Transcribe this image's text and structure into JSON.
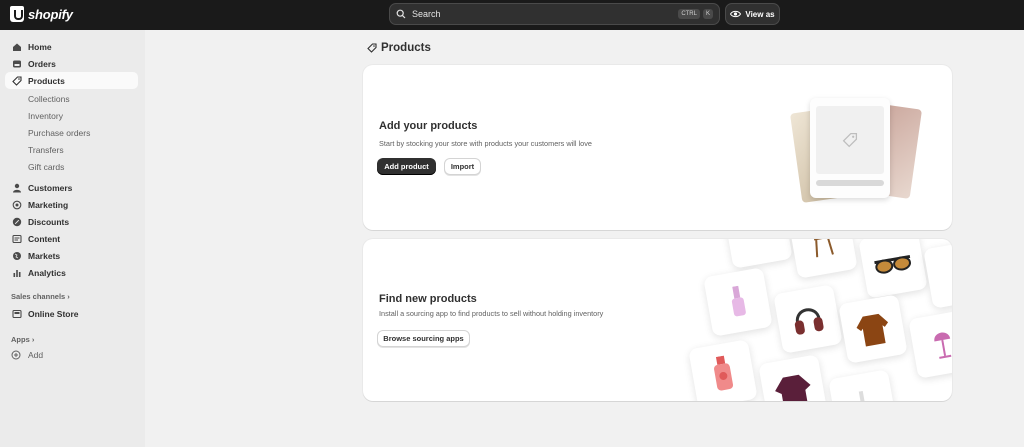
{
  "app": {
    "logo_text": "shopify"
  },
  "search": {
    "placeholder": "Search",
    "shortcut_ctrl": "CTRL",
    "shortcut_key": "K"
  },
  "view_as": {
    "label": "View as"
  },
  "sidebar": {
    "primary": [
      {
        "label": "Home",
        "icon": "home-icon"
      },
      {
        "label": "Orders",
        "icon": "orders-icon"
      },
      {
        "label": "Products",
        "icon": "tag-icon",
        "active": true
      }
    ],
    "product_sub": [
      "Collections",
      "Inventory",
      "Purchase orders",
      "Transfers",
      "Gift cards"
    ],
    "secondary": [
      {
        "label": "Customers",
        "icon": "person-icon"
      },
      {
        "label": "Marketing",
        "icon": "target-icon"
      },
      {
        "label": "Discounts",
        "icon": "discount-icon"
      },
      {
        "label": "Content",
        "icon": "content-icon"
      },
      {
        "label": "Markets",
        "icon": "globe-icon"
      },
      {
        "label": "Analytics",
        "icon": "bar-chart-icon"
      }
    ],
    "sales_channels_label": "Sales channels",
    "online_store": "Online Store",
    "apps_label": "Apps",
    "add_label": "Add"
  },
  "main": {
    "title": "Products",
    "add_card": {
      "title": "Add your products",
      "description": "Start by stocking your store with products your customers will love",
      "primary_button": "Add product",
      "secondary_button": "Import"
    },
    "find_card": {
      "title": "Find new products",
      "description": "Install a sourcing app to find products to sell without holding inventory",
      "button": "Browse sourcing apps"
    }
  },
  "colors": {
    "topbar": "#1a1a1a",
    "sidebar": "#ebebeb",
    "background": "#f1f1f1",
    "primary_button": "#303030"
  }
}
